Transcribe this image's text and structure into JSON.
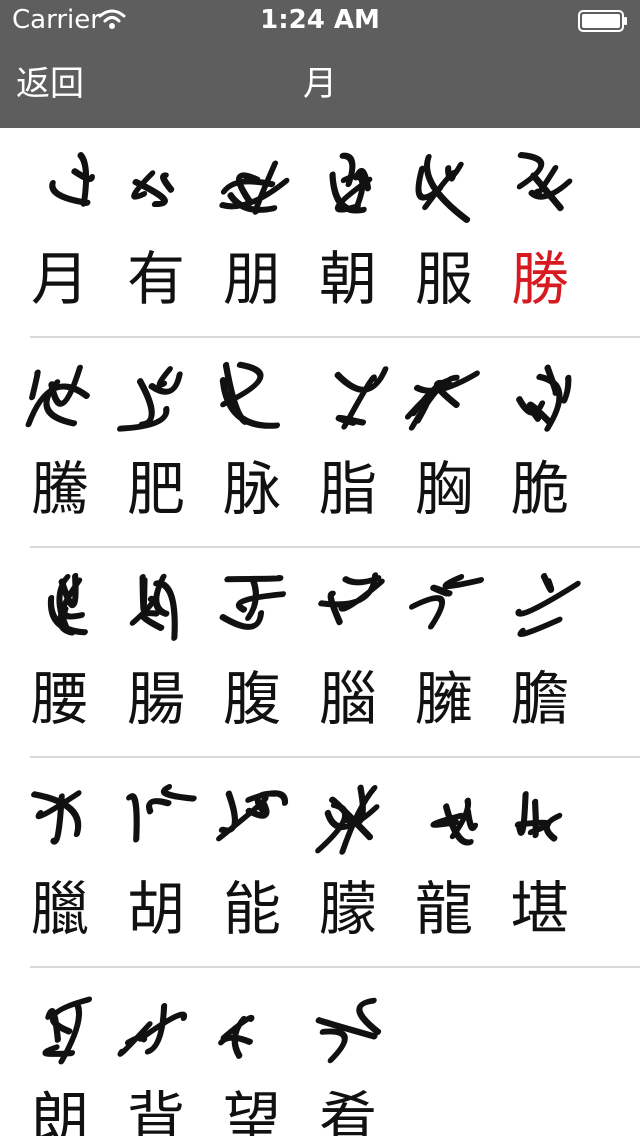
{
  "status_bar": {
    "carrier": "Carrier",
    "time": "1:24 AM"
  },
  "nav": {
    "back_label": "返回",
    "title": "月"
  },
  "colors": {
    "nav_background": "#5e5e5e",
    "highlight": "#d71920",
    "separator": "#d9d9d9"
  },
  "rows": [
    {
      "chars": [
        {
          "label": "月",
          "highlighted": false
        },
        {
          "label": "有",
          "highlighted": false
        },
        {
          "label": "朋",
          "highlighted": false
        },
        {
          "label": "朝",
          "highlighted": false
        },
        {
          "label": "服",
          "highlighted": false
        },
        {
          "label": "勝",
          "highlighted": true
        }
      ]
    },
    {
      "chars": [
        {
          "label": "騰",
          "highlighted": false
        },
        {
          "label": "肥",
          "highlighted": false
        },
        {
          "label": "脉",
          "highlighted": false
        },
        {
          "label": "脂",
          "highlighted": false
        },
        {
          "label": "胸",
          "highlighted": false
        },
        {
          "label": "脆",
          "highlighted": false
        }
      ]
    },
    {
      "chars": [
        {
          "label": "腰",
          "highlighted": false
        },
        {
          "label": "腸",
          "highlighted": false
        },
        {
          "label": "腹",
          "highlighted": false
        },
        {
          "label": "腦",
          "highlighted": false
        },
        {
          "label": "臃",
          "highlighted": false
        },
        {
          "label": "膽",
          "highlighted": false
        }
      ]
    },
    {
      "chars": [
        {
          "label": "臘",
          "highlighted": false
        },
        {
          "label": "胡",
          "highlighted": false
        },
        {
          "label": "能",
          "highlighted": false
        },
        {
          "label": "朦",
          "highlighted": false
        },
        {
          "label": "龍",
          "highlighted": false
        },
        {
          "label": "堪",
          "highlighted": false
        }
      ]
    },
    {
      "chars": [
        {
          "label": "朗",
          "highlighted": false
        },
        {
          "label": "背",
          "highlighted": false
        },
        {
          "label": "望",
          "highlighted": false
        },
        {
          "label": "肴",
          "highlighted": false
        }
      ]
    }
  ]
}
